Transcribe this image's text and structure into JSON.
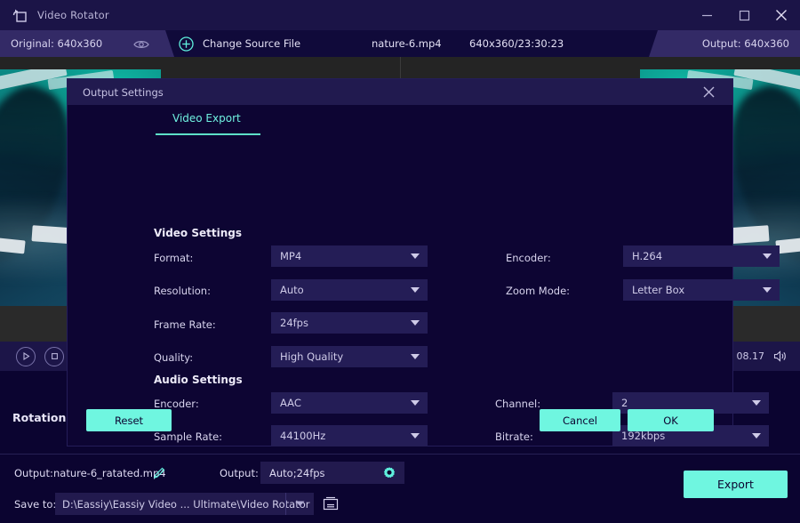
{
  "window": {
    "title": "Video Rotator",
    "logo_icon": "video-rotator-logo-icon",
    "minimize_icon": "minimize-icon",
    "maximize_icon": "maximize-icon",
    "close_icon": "close-icon"
  },
  "toolbar": {
    "original_label": "Original: 640x360",
    "eye_icon": "eye-icon",
    "plus_icon": "plus-circle-icon",
    "change_source_label": "Change Source File",
    "source_file": "nature-6.mp4",
    "source_meta": "640x360/23:30:23",
    "output_label": "Output: 640x360"
  },
  "transport": {
    "play_icon": "play-icon",
    "stop_icon": "stop-icon",
    "time": "08.17",
    "volume_icon": "volume-icon"
  },
  "rotation": {
    "label": "Rotation:"
  },
  "bottom": {
    "output_label": "Output:",
    "output_filename": "nature-6_ratated.mp4",
    "edit_icon": "pencil-edit-icon",
    "output2_label": "Output:",
    "output2_value": "Auto;24fps",
    "settings_icon": "gear-icon",
    "save_to_label": "Save to:",
    "save_to_path": "D:\\Eassiy\\Eassiy Video ... Ultimate\\Video Rotator",
    "dropdown_icon": "chevron-down-icon",
    "folder_icon": "folder-icon",
    "export_label": "Export"
  },
  "dialog": {
    "title": "Output Settings",
    "close_icon": "close-icon",
    "tab_label": "Video Export",
    "video_section_title": "Video Settings",
    "audio_section_title": "Audio Settings",
    "fields": {
      "format": {
        "label": "Format:",
        "value": "MP4"
      },
      "resolution": {
        "label": "Resolution:",
        "value": "Auto"
      },
      "frame_rate": {
        "label": "Frame Rate:",
        "value": "24fps"
      },
      "quality": {
        "label": "Quality:",
        "value": "High Quality"
      },
      "video_encoder": {
        "label": "Encoder:",
        "value": "H.264"
      },
      "zoom_mode": {
        "label": "Zoom Mode:",
        "value": "Letter Box"
      },
      "audio_encoder": {
        "label": "Encoder:",
        "value": "AAC"
      },
      "sample_rate": {
        "label": "Sample Rate:",
        "value": "44100Hz"
      },
      "channel": {
        "label": "Channel:",
        "value": "2"
      },
      "bitrate": {
        "label": "Bitrate:",
        "value": "192kbps"
      }
    },
    "buttons": {
      "reset": "Reset",
      "cancel": "Cancel",
      "ok": "OK"
    }
  },
  "colors": {
    "accent": "#6ff6e0",
    "app_background": "#0b0430",
    "titlebar": "#1b1447",
    "dialog_body": "#0d0533",
    "dialog_titlebar": "#211a4f",
    "select_background": "#241d56",
    "tag_background": "#332a66"
  }
}
